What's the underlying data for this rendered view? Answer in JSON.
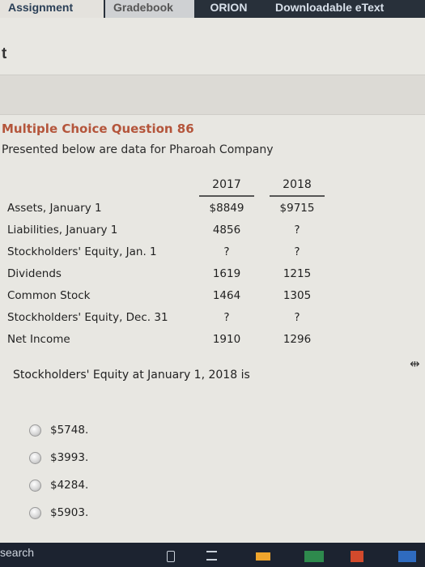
{
  "tabs": {
    "assignment": "Assignment",
    "gradebook": "Gradebook",
    "orion": "ORION",
    "downloadable": "Downloadable eText"
  },
  "header_fragment": "t",
  "question": {
    "title": "Multiple Choice Question 86",
    "intro": "Presented below are data for Pharoah Company",
    "year1": "2017",
    "year2": "2018",
    "rows": [
      {
        "label": "Assets, January 1",
        "v2017": "$8849",
        "v2018": "$9715"
      },
      {
        "label": "Liabilities, January 1",
        "v2017": "4856",
        "v2018": "?"
      },
      {
        "label": "Stockholders' Equity, Jan. 1",
        "v2017": "?",
        "v2018": "?"
      },
      {
        "label": "Dividends",
        "v2017": "1619",
        "v2018": "1215"
      },
      {
        "label": "Common Stock",
        "v2017": "1464",
        "v2018": "1305"
      },
      {
        "label": "Stockholders' Equity, Dec. 31",
        "v2017": "?",
        "v2018": "?"
      },
      {
        "label": "Net Income",
        "v2017": "1910",
        "v2018": "1296"
      }
    ],
    "prompt": "Stockholders' Equity at January 1, 2018 is",
    "options": [
      "$5748.",
      "$3993.",
      "$4284.",
      "$5903."
    ]
  },
  "taskbar": {
    "search": "search"
  }
}
